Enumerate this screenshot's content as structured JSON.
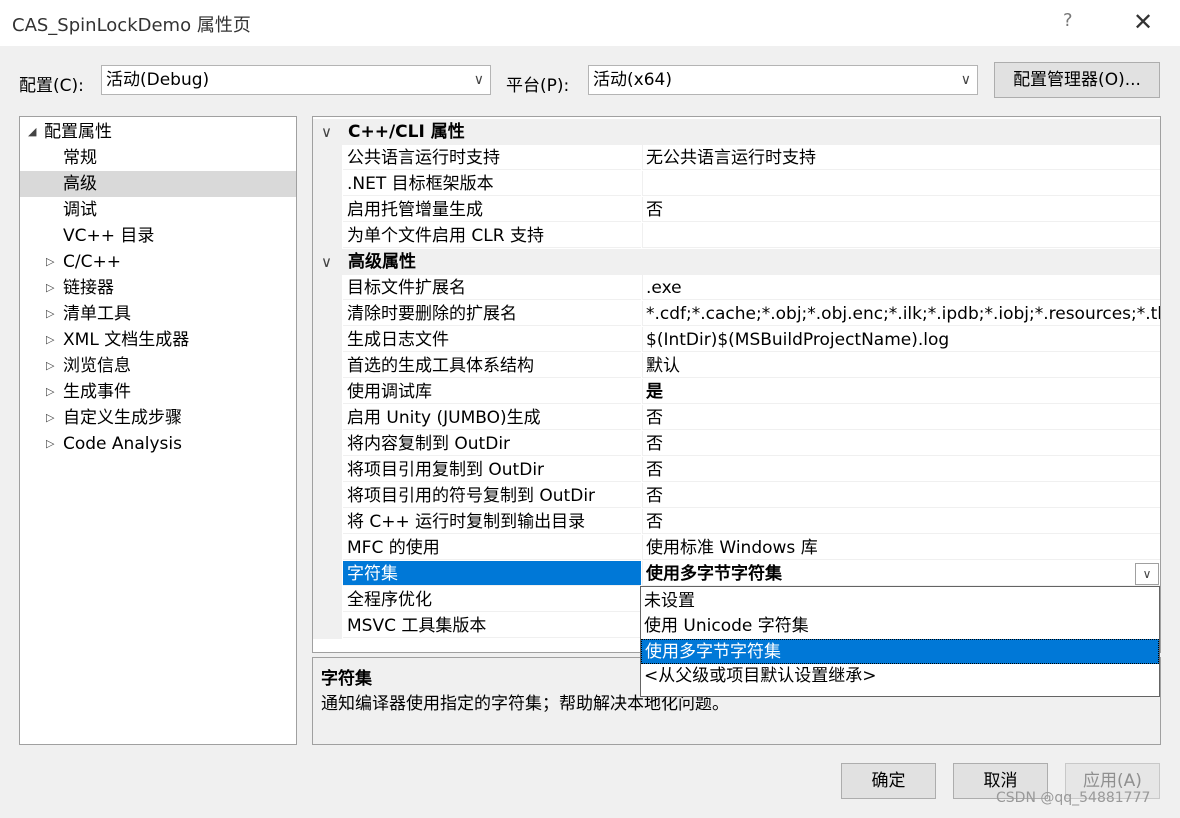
{
  "window": {
    "title": "CAS_SpinLockDemo 属性页",
    "help_glyph": "?",
    "close_glyph": "✕"
  },
  "toolbar": {
    "config_label": "配置(C):",
    "config_value": "活动(Debug)",
    "platform_label": "平台(P):",
    "platform_value": "活动(x64)",
    "config_manager_label": "配置管理器(O)..."
  },
  "tree": {
    "items": [
      {
        "label": "配置属性",
        "level": 0,
        "expander": "◢",
        "selected": false
      },
      {
        "label": "常规",
        "level": 1,
        "expander": "",
        "selected": false
      },
      {
        "label": "高级",
        "level": 1,
        "expander": "",
        "selected": true
      },
      {
        "label": "调试",
        "level": 1,
        "expander": "",
        "selected": false
      },
      {
        "label": "VC++ 目录",
        "level": 1,
        "expander": "",
        "selected": false
      },
      {
        "label": "C/C++",
        "level": 1,
        "expander": "▷",
        "selected": false
      },
      {
        "label": "链接器",
        "level": 1,
        "expander": "▷",
        "selected": false
      },
      {
        "label": "清单工具",
        "level": 1,
        "expander": "▷",
        "selected": false
      },
      {
        "label": "XML 文档生成器",
        "level": 1,
        "expander": "▷",
        "selected": false
      },
      {
        "label": "浏览信息",
        "level": 1,
        "expander": "▷",
        "selected": false
      },
      {
        "label": "生成事件",
        "level": 1,
        "expander": "▷",
        "selected": false
      },
      {
        "label": "自定义生成步骤",
        "level": 1,
        "expander": "▷",
        "selected": false
      },
      {
        "label": "Code Analysis",
        "level": 1,
        "expander": "▷",
        "selected": false
      }
    ]
  },
  "grid": {
    "chevron": "∨",
    "rows": [
      {
        "type": "category",
        "label": "C++/CLI 属性"
      },
      {
        "type": "prop",
        "name": "公共语言运行时支持",
        "value": "无公共语言运行时支持"
      },
      {
        "type": "prop",
        "name": ".NET 目标框架版本",
        "value": ""
      },
      {
        "type": "prop",
        "name": "启用托管增量生成",
        "value": "否"
      },
      {
        "type": "prop",
        "name": "为单个文件启用 CLR 支持",
        "value": ""
      },
      {
        "type": "category",
        "label": "高级属性"
      },
      {
        "type": "prop",
        "name": "目标文件扩展名",
        "value": ".exe"
      },
      {
        "type": "prop",
        "name": "清除时要删除的扩展名",
        "value": "*.cdf;*.cache;*.obj;*.obj.enc;*.ilk;*.ipdb;*.iobj;*.resources;*.tlb;*"
      },
      {
        "type": "prop",
        "name": "生成日志文件",
        "value": "$(IntDir)$(MSBuildProjectName).log"
      },
      {
        "type": "prop",
        "name": "首选的生成工具体系结构",
        "value": "默认"
      },
      {
        "type": "prop",
        "name": "使用调试库",
        "value": "是",
        "bold": true
      },
      {
        "type": "prop",
        "name": "启用 Unity (JUMBO)生成",
        "value": "否"
      },
      {
        "type": "prop",
        "name": "将内容复制到 OutDir",
        "value": "否"
      },
      {
        "type": "prop",
        "name": "将项目引用复制到 OutDir",
        "value": "否"
      },
      {
        "type": "prop",
        "name": "将项目引用的符号复制到 OutDir",
        "value": "否"
      },
      {
        "type": "prop",
        "name": "将 C++ 运行时复制到输出目录",
        "value": "否"
      },
      {
        "type": "prop",
        "name": "MFC 的使用",
        "value": "使用标准 Windows 库"
      },
      {
        "type": "prop",
        "name": "字符集",
        "value": "使用多字节字符集",
        "bold": true,
        "selected": true,
        "dropdown": true
      },
      {
        "type": "prop",
        "name": "全程序优化",
        "value": ""
      },
      {
        "type": "prop",
        "name": "MSVC 工具集版本",
        "value": ""
      }
    ]
  },
  "dropdown": {
    "options": [
      "未设置",
      "使用 Unicode 字符集",
      "使用多字节字符集",
      "<从父级或项目默认设置继承>"
    ],
    "selected_index": 2,
    "arrow_glyph": "∨"
  },
  "description": {
    "title": "字符集",
    "text": "通知编译器使用指定的字符集；帮助解决本地化问题。"
  },
  "buttons": {
    "ok": "确定",
    "cancel": "取消",
    "apply": "应用(A)"
  },
  "watermark": "CSDN @qq_54881777",
  "colors": {
    "selection": "#0078d7",
    "tree_selection": "#d9d9d9",
    "background": "#f0f0f0"
  }
}
